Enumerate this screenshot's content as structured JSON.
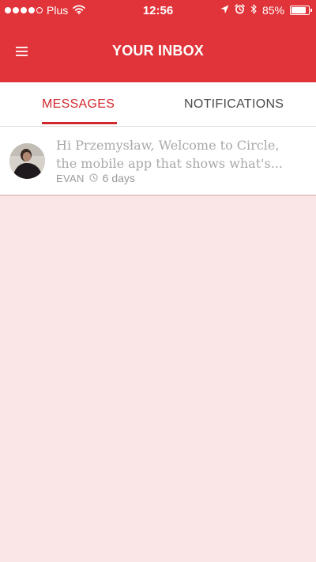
{
  "status_bar": {
    "carrier": "Plus",
    "time": "12:56",
    "battery": "85%",
    "signal_bars": 4,
    "signal_max": 5,
    "battery_level": 0.85
  },
  "header": {
    "title": "YOUR INBOX",
    "background_color": "#e0343a"
  },
  "tabs": [
    {
      "label": "MESSAGES",
      "active": true
    },
    {
      "label": "NOTIFICATIONS",
      "active": false
    }
  ],
  "accent_color": "#d2272d",
  "messages": [
    {
      "line1": "Hi Przemysław, Welcome to Circle,",
      "line2": "the mobile app that shows what's...",
      "sender": "EVAN",
      "time": "6 days"
    }
  ],
  "icons": {
    "menu": "hamburger-menu-icon",
    "wifi": "wifi-icon",
    "location": "location-arrow-icon",
    "alarm": "alarm-clock-icon",
    "bluetooth": "bluetooth-icon",
    "clock": "clock-icon"
  }
}
